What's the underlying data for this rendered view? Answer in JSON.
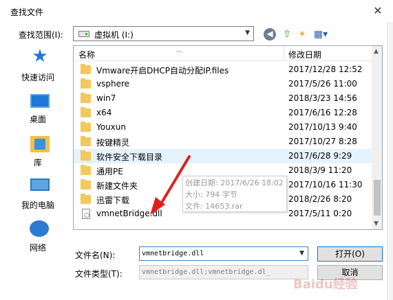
{
  "window": {
    "title": "查找文件",
    "close_glyph": "✕"
  },
  "lookin": {
    "label": "查找范围(I):",
    "value": "虚拟机 (I:)"
  },
  "toolbar": {
    "back": "◀",
    "up": "⇧",
    "newfolder": "✦",
    "views": "▦▾"
  },
  "places": [
    {
      "label": "快速访问",
      "icon": "quick-access-star-icon"
    },
    {
      "label": "桌面",
      "icon": "desktop-icon"
    },
    {
      "label": "库",
      "icon": "library-icon"
    },
    {
      "label": "我的电脑",
      "icon": "computer-icon"
    },
    {
      "label": "网络",
      "icon": "network-icon"
    }
  ],
  "columns": {
    "name": "名称",
    "date": "修改日期"
  },
  "files": [
    {
      "name": "Vmware开启DHCP自动分配IP.files",
      "date": "2017/12/28 12:52",
      "type": "folder"
    },
    {
      "name": "vsphere",
      "date": "2017/5/26 11:00",
      "type": "folder"
    },
    {
      "name": "win7",
      "date": "2018/3/23 14:56",
      "type": "folder"
    },
    {
      "name": "x64",
      "date": "2017/6/16 12:28",
      "type": "folder"
    },
    {
      "name": "Youxun",
      "date": "2017/10/13 9:40",
      "type": "folder"
    },
    {
      "name": "按键精灵",
      "date": "2017/10/27 8:28",
      "type": "folder"
    },
    {
      "name": "软件安全下载目录",
      "date": "2017/6/28 9:29",
      "type": "folder",
      "selected": true
    },
    {
      "name": "通用PE",
      "date": "2018/3/9 11:20",
      "type": "folder"
    },
    {
      "name": "新建文件夹",
      "date": "2017/10/16 11:30",
      "type": "folder"
    },
    {
      "name": "迅雷下载",
      "date": "2018/2/26 8:20",
      "type": "folder"
    },
    {
      "name": "vmnetBridge.dll",
      "date": "2017/5/11 0:20",
      "type": "file"
    }
  ],
  "tooltip": {
    "created": "创建日期: 2017/6/26 18:02",
    "size": "大小: 794 字节",
    "file": "文件: 14653.rar"
  },
  "filename": {
    "label": "文件名(N):",
    "value": "vmnetbridge.dll"
  },
  "filetype": {
    "label": "文件类型(T):",
    "value": "vmnetbridge.dll;vmnetbridge.dl_"
  },
  "buttons": {
    "open": "打开(O)",
    "cancel": "取消"
  },
  "watermark": "Baidu经验",
  "colors": {
    "accent": "#0078d7",
    "selection": "#e5f3ff",
    "folder": "#f3c85d",
    "annotation_arrow": "#e02020"
  }
}
